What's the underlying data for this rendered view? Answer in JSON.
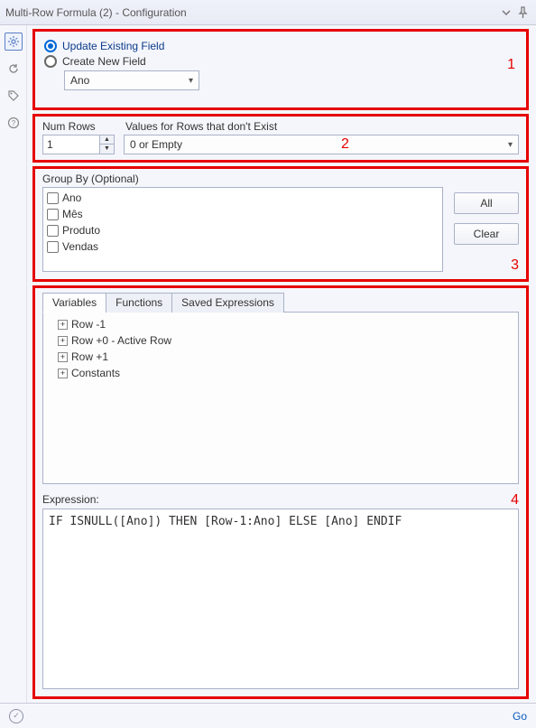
{
  "title": "Multi-Row Formula (2) - Configuration",
  "annotations": {
    "n1": "1",
    "n2": "2",
    "n3": "3",
    "n4": "4"
  },
  "section1": {
    "update_label": "Update Existing Field",
    "create_label": "Create New  Field",
    "selected_field": "Ano"
  },
  "section2": {
    "numrows_header": "Num Rows",
    "values_header": "Values for Rows that don't Exist",
    "numrows_value": "1",
    "values_selected": "0 or Empty"
  },
  "section3": {
    "label": "Group By (Optional)",
    "items": [
      "Ano",
      "Mês",
      "Produto",
      "Vendas"
    ],
    "btn_all": "All",
    "btn_clear": "Clear"
  },
  "section4": {
    "tabs": {
      "variables": "Variables",
      "functions": "Functions",
      "saved": "Saved Expressions"
    },
    "tree": {
      "row_m1": "Row -1",
      "row_0": "Row +0 - Active Row",
      "row_p1": "Row +1",
      "constants": "Constants"
    },
    "expr_label": "Expression:",
    "expression": "IF ISNULL([Ano]) THEN [Row-1:Ano] ELSE [Ano] ENDIF"
  },
  "footer": {
    "go": "Go"
  }
}
